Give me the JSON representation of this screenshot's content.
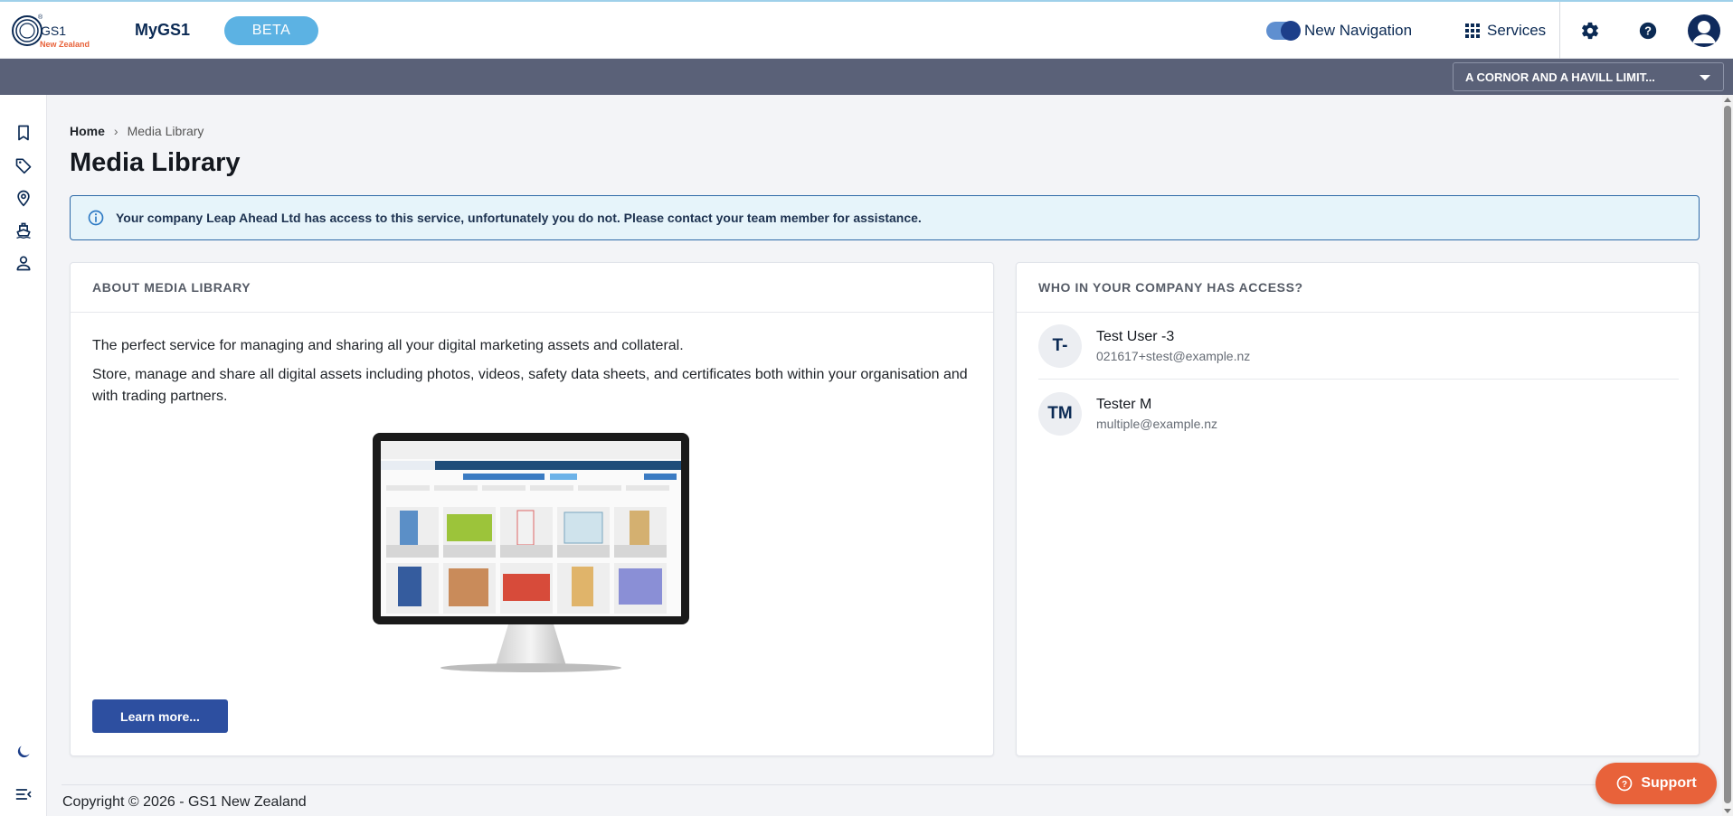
{
  "header": {
    "logo": {
      "text": "GS1",
      "sub": "New Zealand"
    },
    "app_name": "MyGS1",
    "beta_label": "BETA",
    "new_navigation_label": "New Navigation",
    "services_label": "Services"
  },
  "company_bar": {
    "selected_company": "A CORNOR AND A HAVILL LIMIT..."
  },
  "breadcrumb": {
    "home": "Home",
    "separator": "›",
    "current": "Media Library"
  },
  "page": {
    "title": "Media Library",
    "alert": "Your company Leap Ahead Ltd has access to this service, unfortunately you do not. Please contact your team member for assistance."
  },
  "about": {
    "heading": "ABOUT MEDIA LIBRARY",
    "paragraph1": "The perfect service for managing and sharing all your digital marketing assets and collateral.",
    "paragraph2": "Store, manage and share all digital assets including photos, videos, safety data sheets, and certificates both within your organisation and with trading partners.",
    "learn_more_label": "Learn more..."
  },
  "access": {
    "heading": "WHO IN YOUR COMPANY HAS ACCESS?",
    "users": [
      {
        "initials": "T-",
        "name": "Test User -3",
        "email": "021617+stest@example.nz"
      },
      {
        "initials": "TM",
        "name": "Tester M",
        "email": "multiple@example.nz"
      }
    ]
  },
  "footer": {
    "copyright": "Copyright © 2026 - GS1 New Zealand"
  },
  "support_label": "Support",
  "colors": {
    "primary": "#2d4fa0",
    "navy": "#0b2a54",
    "beta": "#5cb2e3",
    "support": "#e8623a",
    "company_bar": "#5a6178",
    "alert_bg": "#e6f4fa"
  },
  "icons": {
    "sidebar": [
      "bookmark-icon",
      "tag-icon",
      "location-pin-icon",
      "ship-icon",
      "person-icon",
      "moon-icon",
      "collapse-menu-icon"
    ],
    "header": [
      "grid-icon",
      "gear-icon",
      "help-icon",
      "account-icon"
    ]
  }
}
